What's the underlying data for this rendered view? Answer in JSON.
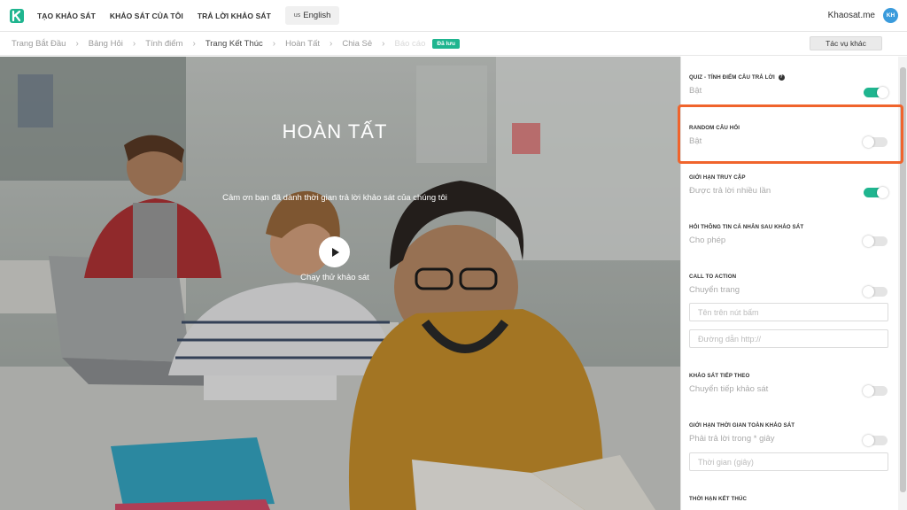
{
  "topnav": {
    "items": [
      "TẠO KHẢO SÁT",
      "KHẢO SÁT CỦA TÔI",
      "TRẢ LỜI KHẢO SÁT"
    ],
    "language": {
      "flag": "us",
      "label": "English"
    },
    "site_name": "Khaosat.me",
    "avatar_initials": "KH"
  },
  "steps": {
    "items": [
      "Trang Bắt Đầu",
      "Bảng Hỏi",
      "Tính điểm",
      "Trang Kết Thúc",
      "Hoàn Tất",
      "Chia Sẻ",
      "Báo cáo"
    ],
    "active_index": 3,
    "saved_badge": "Đã lưu",
    "other_actions": "Tác vụ khác"
  },
  "preview": {
    "title": "HOÀN TẤT",
    "message": "Cảm ơn bạn đã dành thời gian trả lời khảo sát của chúng tôi",
    "try_label": "Chạy thử khảo sát"
  },
  "settings": {
    "quiz": {
      "title": "QUIZ - TÍNH ĐIỂM CÂU TRẢ LỜI",
      "value": "Bật",
      "on": true
    },
    "random": {
      "title": "RANDOM CÂU HỎI",
      "value": "Bật",
      "on": false
    },
    "access_limit": {
      "title": "GIỚI HẠN TRUY CẬP",
      "value": "Được trả lời nhiều lần",
      "on": true
    },
    "personal_info": {
      "title": "HỎI THÔNG TIN CÁ NHÂN SAU KHẢO SÁT",
      "value": "Cho phép",
      "on": false
    },
    "cta": {
      "title": "CALL TO ACTION",
      "value": "Chuyển trang",
      "on": false,
      "button_placeholder": "Tên trên nút bấm",
      "url_placeholder": "Đường dẫn http://"
    },
    "next_survey": {
      "title": "KHẢO SÁT TIẾP THEO",
      "value": "Chuyển tiếp khảo sát",
      "on": false
    },
    "time_limit": {
      "title": "GIỚI HẠN THỜI GIAN TOÀN KHẢO SÁT",
      "value": "Phải trả lời trong * giây",
      "on": false,
      "placeholder": "Thời gian (giây)"
    },
    "end_time": {
      "title": "THỜI HẠN KẾT THÚC"
    }
  },
  "colors": {
    "accent": "#1fb58f",
    "highlight": "#f0642c",
    "avatar": "#3a9bdc"
  }
}
